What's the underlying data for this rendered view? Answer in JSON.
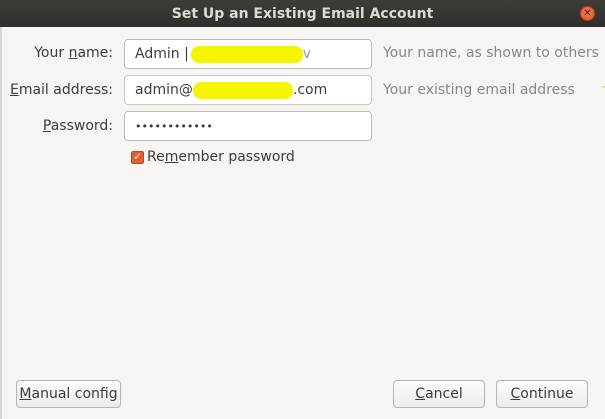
{
  "window": {
    "title": "Set Up an Existing Email Account"
  },
  "form": {
    "name_label_pre": "Your ",
    "name_label_u": "n",
    "name_label_post": "ame:",
    "name_value": "Admin |",
    "name_value_tail": "v",
    "name_hint": "Your name, as shown to others",
    "email_label_u": "E",
    "email_label_post": "mail address:",
    "email_value_pre": "admin@",
    "email_value_post": ".com",
    "email_hint": "Your existing email address",
    "password_label_u": "P",
    "password_label_post": "assword:",
    "password_value": "••••••••••••",
    "remember_pre": "Re",
    "remember_u": "m",
    "remember_post": "ember password",
    "remember_checked": true
  },
  "buttons": {
    "manual_u": "M",
    "manual_post": "anual config",
    "cancel_pre": "",
    "cancel_u": "C",
    "cancel_post": "ancel",
    "continue_pre": "",
    "continue_u": "C",
    "continue_post": "ontinue"
  },
  "icons": {
    "close": "close-icon",
    "checkbox": "checkmark-icon"
  },
  "colors": {
    "accent": "#e05e2f",
    "highlight": "#f5f500"
  }
}
